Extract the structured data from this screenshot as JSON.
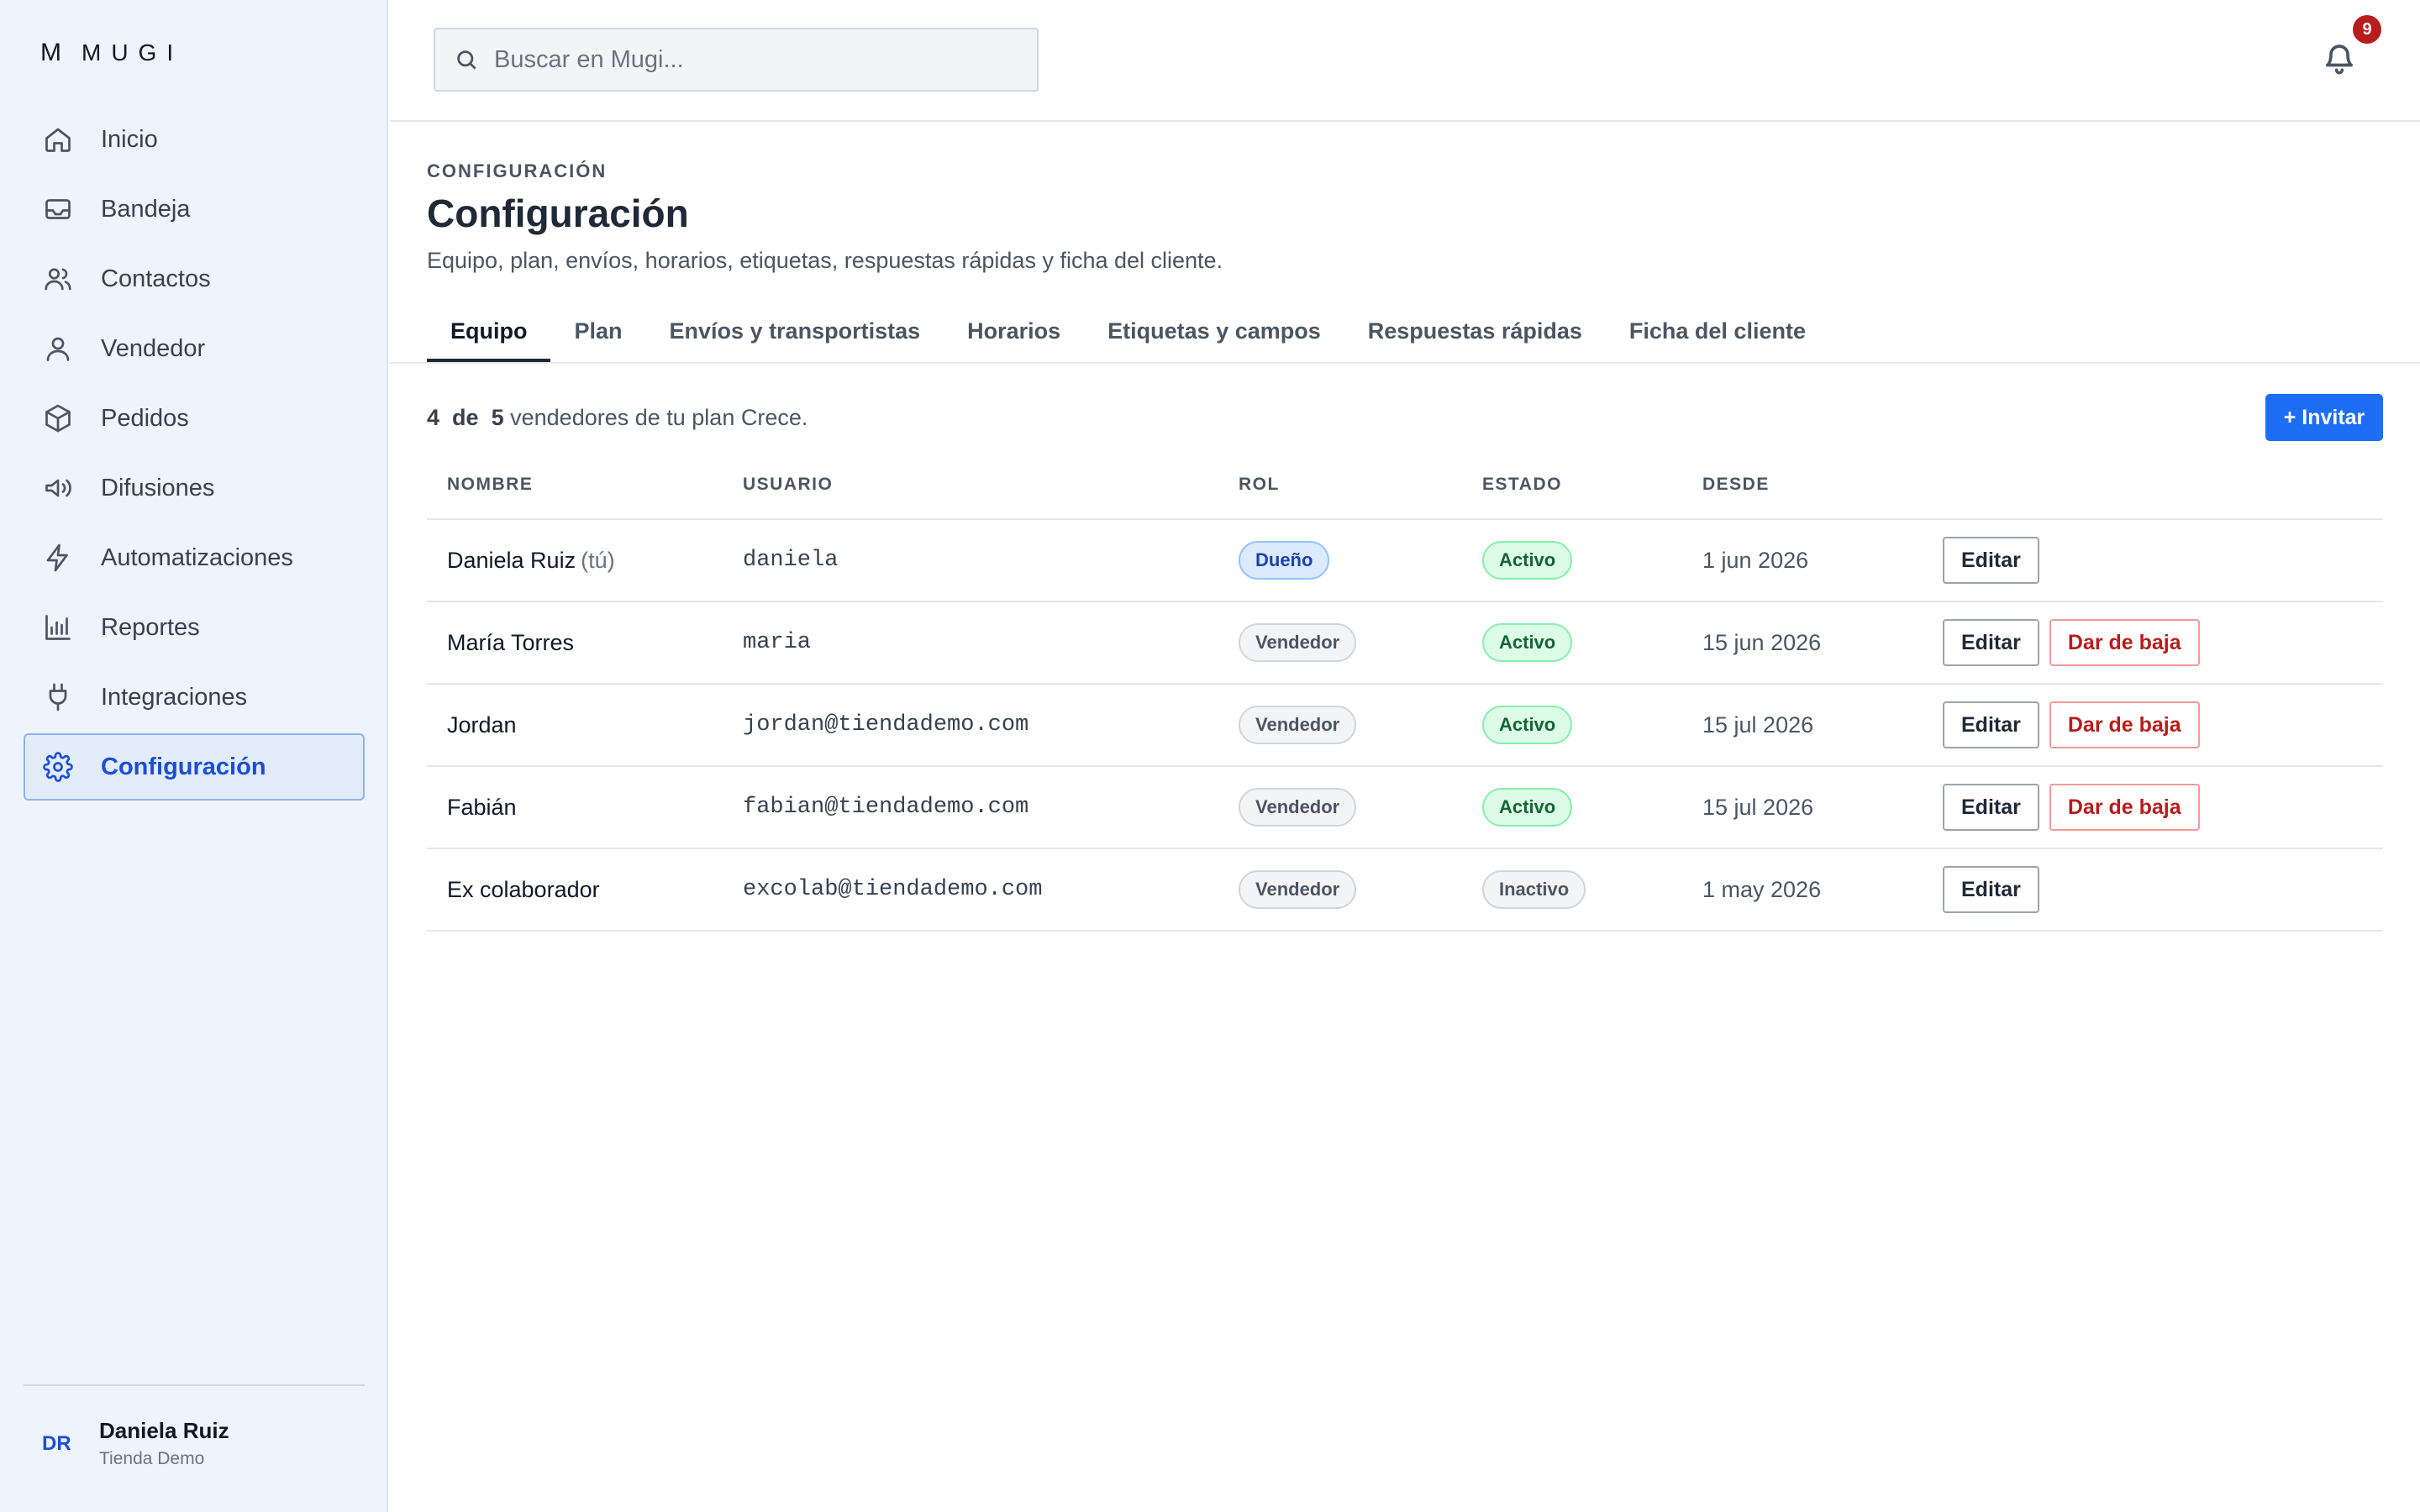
{
  "app": {
    "logo_mark": "M",
    "logo_name": "MUGI"
  },
  "sidebar": {
    "items": [
      {
        "label": "Inicio",
        "icon": "home-icon"
      },
      {
        "label": "Bandeja",
        "icon": "inbox-icon"
      },
      {
        "label": "Contactos",
        "icon": "contacts-icon"
      },
      {
        "label": "Vendedor",
        "icon": "user-icon"
      },
      {
        "label": "Pedidos",
        "icon": "box-icon"
      },
      {
        "label": "Difusiones",
        "icon": "megaphone-icon"
      },
      {
        "label": "Automatizaciones",
        "icon": "bolt-icon"
      },
      {
        "label": "Reportes",
        "icon": "bar-chart-icon"
      },
      {
        "label": "Integraciones",
        "icon": "plug-icon"
      },
      {
        "label": "Configuración",
        "icon": "gear-icon",
        "active": true
      }
    ],
    "user": {
      "initials": "DR",
      "name": "Daniela Ruiz",
      "store": "Tienda Demo"
    }
  },
  "topbar": {
    "search_placeholder": "Buscar en Mugi...",
    "notifications_count": "9"
  },
  "page": {
    "eyebrow": "CONFIGURACIÓN",
    "title": "Configuración",
    "subtitle": "Equipo, plan, envíos, horarios, etiquetas, respuestas rápidas y ficha del cliente."
  },
  "tabs": [
    {
      "label": "Equipo",
      "active": true
    },
    {
      "label": "Plan"
    },
    {
      "label": "Envíos y transportistas"
    },
    {
      "label": "Horarios"
    },
    {
      "label": "Etiquetas y campos"
    },
    {
      "label": "Respuestas rápidas"
    },
    {
      "label": "Ficha del cliente"
    }
  ],
  "team": {
    "seats_used": "4",
    "seats_of": "de",
    "seats_total": "5",
    "seats_suffix": "vendedores de tu plan Crece.",
    "invite_label": "+ Invitar",
    "columns": [
      "NOMBRE",
      "USUARIO",
      "ROL",
      "ESTADO",
      "DESDE"
    ],
    "rows": [
      {
        "name": "Daniela Ruiz",
        "you": "(tú)",
        "user": "daniela",
        "role": "Dueño",
        "status": "Activo",
        "since": "1 jun 2026",
        "edit": "Editar",
        "drop": ""
      },
      {
        "name": "María Torres",
        "you": "",
        "user": "maria",
        "role": "Vendedor",
        "status": "Activo",
        "since": "15 jun 2026",
        "edit": "Editar",
        "drop": "Dar de baja"
      },
      {
        "name": "Jordan",
        "you": "",
        "user": "jordan@tiendademo.com",
        "role": "Vendedor",
        "status": "Activo",
        "since": "15 jul 2026",
        "edit": "Editar",
        "drop": "Dar de baja"
      },
      {
        "name": "Fabián",
        "you": "",
        "user": "fabian@tiendademo.com",
        "role": "Vendedor",
        "status": "Activo",
        "since": "15 jul 2026",
        "edit": "Editar",
        "drop": "Dar de baja"
      },
      {
        "name": "Ex colaborador",
        "you": "",
        "user": "excolab@tiendademo.com",
        "role": "Vendedor",
        "status": "Inactivo",
        "since": "1 may 2026",
        "edit": "Editar",
        "drop": ""
      }
    ]
  },
  "colors": {
    "accent": "#1d6ef5",
    "sidebar_bg": "#eef3fc",
    "danger": "#b91c1c",
    "success": "#166534"
  }
}
